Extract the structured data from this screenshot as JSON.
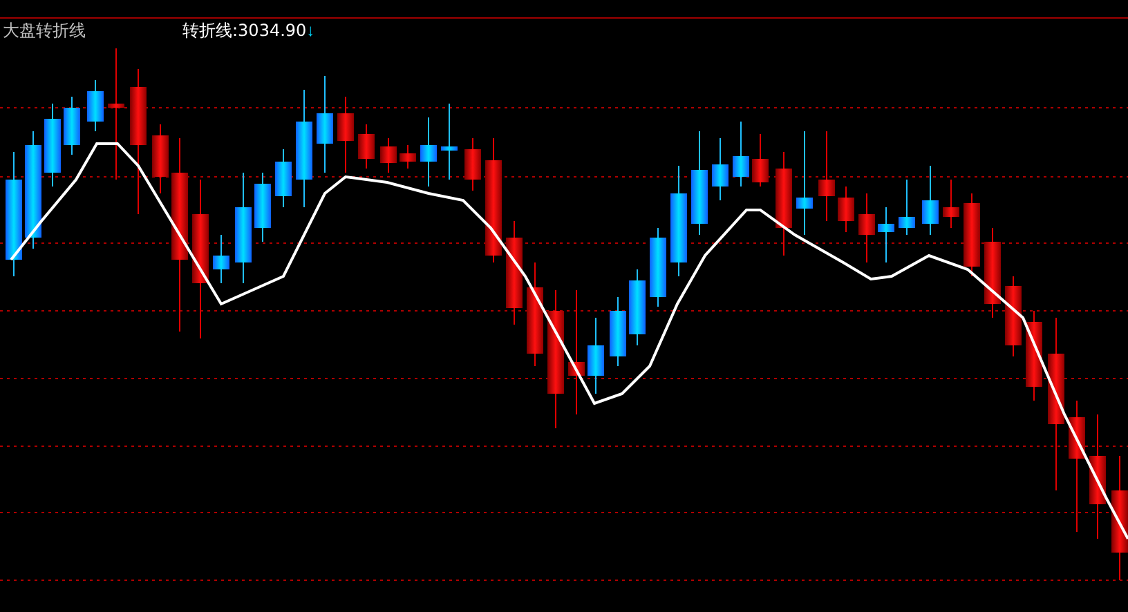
{
  "title": "大盘转折线",
  "legend": {
    "label": "转折线:3034.90",
    "arrow": "↓"
  }
}
